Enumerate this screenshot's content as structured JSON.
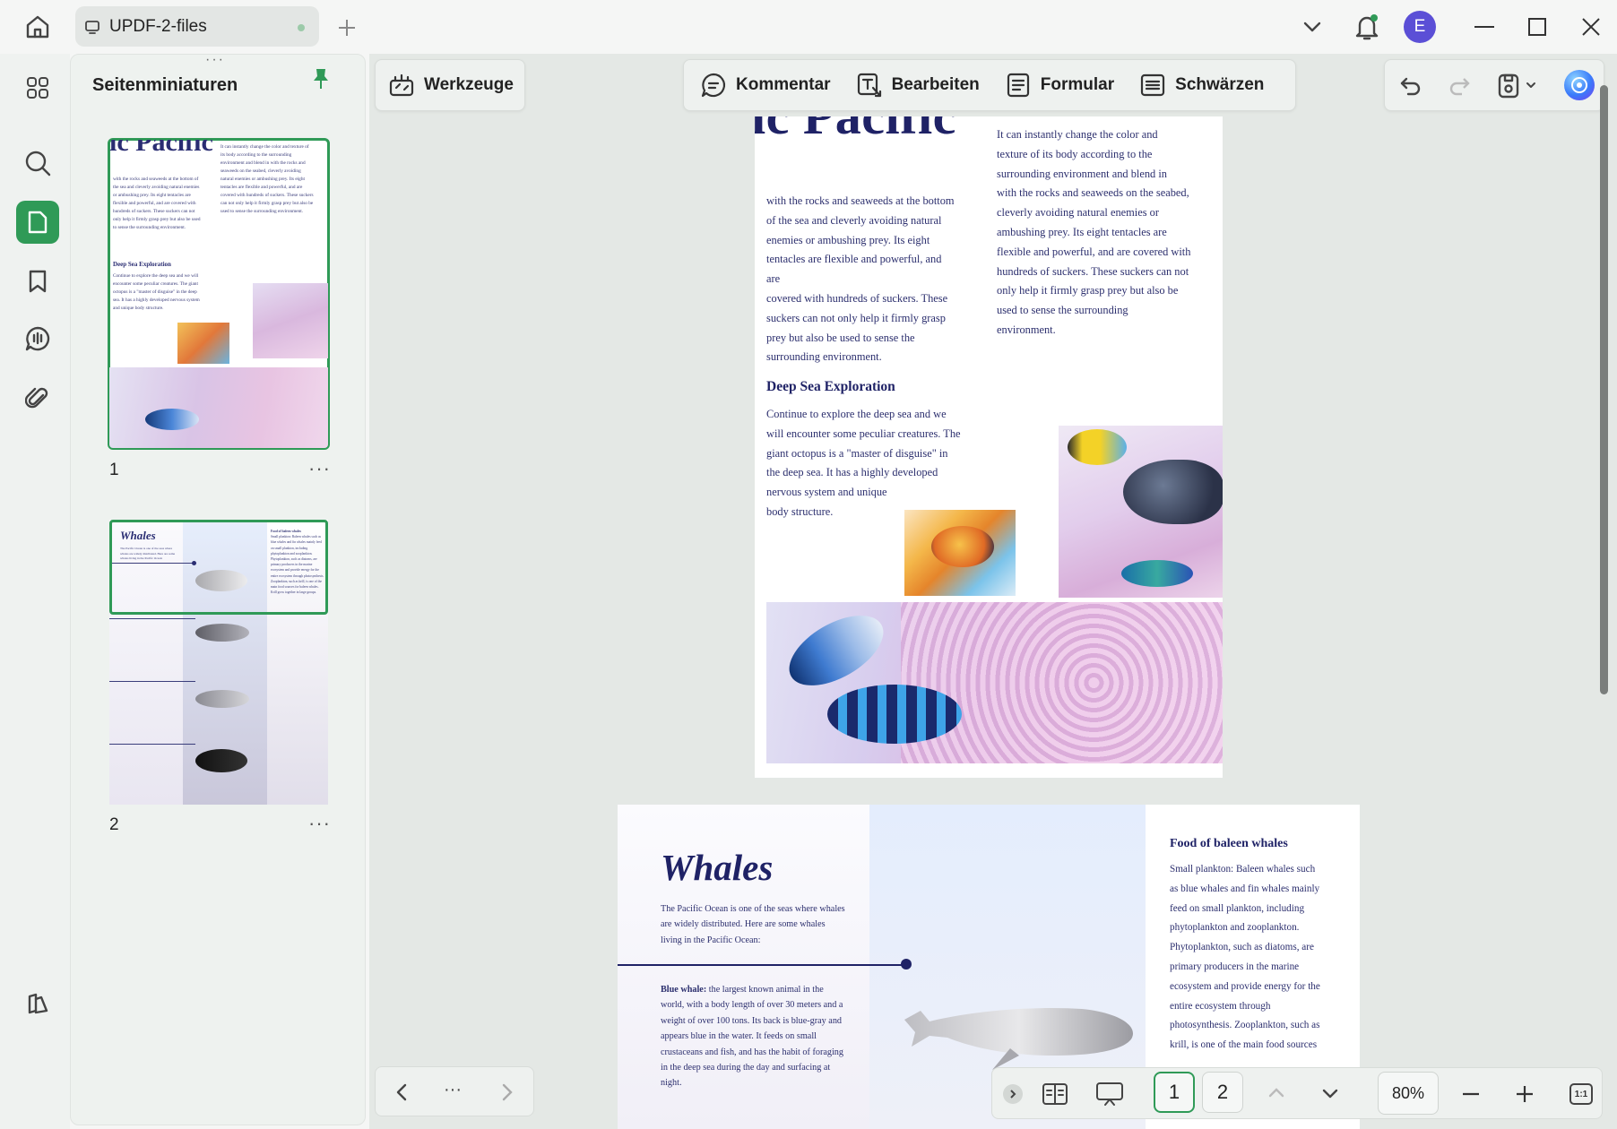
{
  "titlebar": {
    "tab_title": "UPDF-2-files",
    "avatar_letter": "E"
  },
  "sidebar": {
    "panel_title": "Seitenminiaturen",
    "thumbnails": [
      {
        "page": "1",
        "more": "···"
      },
      {
        "page": "2",
        "more": "···"
      }
    ]
  },
  "toolbar": {
    "tools_label": "Werkzeuge",
    "comment_label": "Kommentar",
    "edit_label": "Bearbeiten",
    "form_label": "Formular",
    "redact_label": "Schwärzen"
  },
  "page1": {
    "title_fragment": "ic Pacific",
    "col_left": [
      "with the rocks and seaweeds at the bottom",
      "of the sea and cleverly avoiding natural",
      "enemies or ambushing prey. Its eight",
      "tentacles are flexible and powerful, and are",
      "covered with hundreds of suckers. These",
      "suckers can not only help it firmly grasp",
      "prey but also be used to sense the",
      "surrounding environment."
    ],
    "col_right": [
      "It can instantly change the color and",
      "texture of its body according to the",
      "surrounding environment and blend in",
      "with the rocks and seaweeds on the seabed,",
      "cleverly avoiding natural enemies or",
      "ambushing prey. Its eight tentacles are",
      "flexible and powerful, and are covered with",
      "hundreds of suckers. These suckers can not",
      "only help it firmly grasp prey but also be",
      "used to sense the surrounding",
      "environment."
    ],
    "section_heading": "Deep Sea Exploration",
    "section_text": [
      "Continue to explore the deep sea and we",
      "will encounter some peculiar creatures. The",
      "giant octopus is a \"master of disguise\" in",
      "the deep sea. It has a highly developed",
      "nervous system and unique",
      "body structure."
    ]
  },
  "page2": {
    "title": "Whales",
    "intro": [
      "The Pacific Ocean is one of the seas where whales",
      "are widely distributed. Here are some whales",
      "living in the Pacific Ocean:"
    ],
    "blue_whale_label": "Blue whale:",
    "blue_whale_text": [
      " the largest known animal in the",
      "world, with a body length of over 30 meters and a",
      "weight of over 100 tons. Its back is blue-gray and",
      "appears blue in the water. It feeds on small",
      "crustaceans and fish, and has the habit of foraging",
      "in the deep sea during the day and surfacing at",
      "night."
    ],
    "right_heading": "Food of baleen whales",
    "right_text": [
      "Small plankton: Baleen whales such",
      "as blue whales and fin whales mainly",
      "feed on small plankton, including",
      "phytoplankton and zooplankton.",
      "Phytoplankton, such as diatoms, are",
      "primary producers in the marine",
      "ecosystem and provide energy for the",
      "entire ecosystem through",
      "photosynthesis. Zooplankton, such as",
      "krill, is one of the main food sources"
    ]
  },
  "bottomnav": {
    "more": "···",
    "page_one": "1",
    "page_two": "2",
    "zoom": "80%",
    "fit_label": "1:1"
  }
}
